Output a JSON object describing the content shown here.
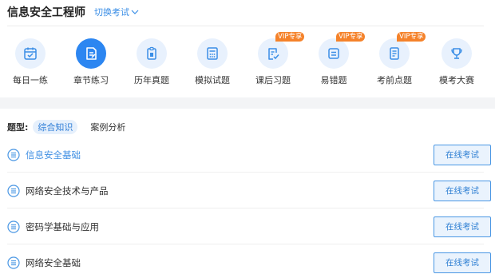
{
  "header": {
    "title": "信息安全工程师",
    "switch_label": "切换考试"
  },
  "nav": [
    {
      "label": "每日一练",
      "icon": "calendar-icon",
      "vip": ""
    },
    {
      "label": "章节练习",
      "icon": "chapter-doc-icon",
      "vip": ""
    },
    {
      "label": "历年真题",
      "icon": "clipboard-icon",
      "vip": ""
    },
    {
      "label": "模拟试题",
      "icon": "calculator-icon",
      "vip": ""
    },
    {
      "label": "课后习题",
      "icon": "checklist-icon",
      "vip": "VIP专享"
    },
    {
      "label": "易错题",
      "icon": "error-card-icon",
      "vip": "VIP专享"
    },
    {
      "label": "考前点题",
      "icon": "notes-icon",
      "vip": "VIP专享"
    },
    {
      "label": "模考大赛",
      "icon": "trophy-icon",
      "vip": ""
    }
  ],
  "type_filter": {
    "label": "题型:",
    "tabs": [
      "综合知识",
      "案例分析"
    ]
  },
  "chapters": [
    {
      "label": "信息安全基础",
      "button": "在线考试"
    },
    {
      "label": "网络安全技术与产品",
      "button": "在线考试"
    },
    {
      "label": "密码学基础与应用",
      "button": "在线考试"
    },
    {
      "label": "网络安全基础",
      "button": "在线考试"
    }
  ],
  "colors": {
    "accent": "#2c86f1",
    "vip": "#f5822a",
    "icon_bg": "#e8f1fd"
  }
}
